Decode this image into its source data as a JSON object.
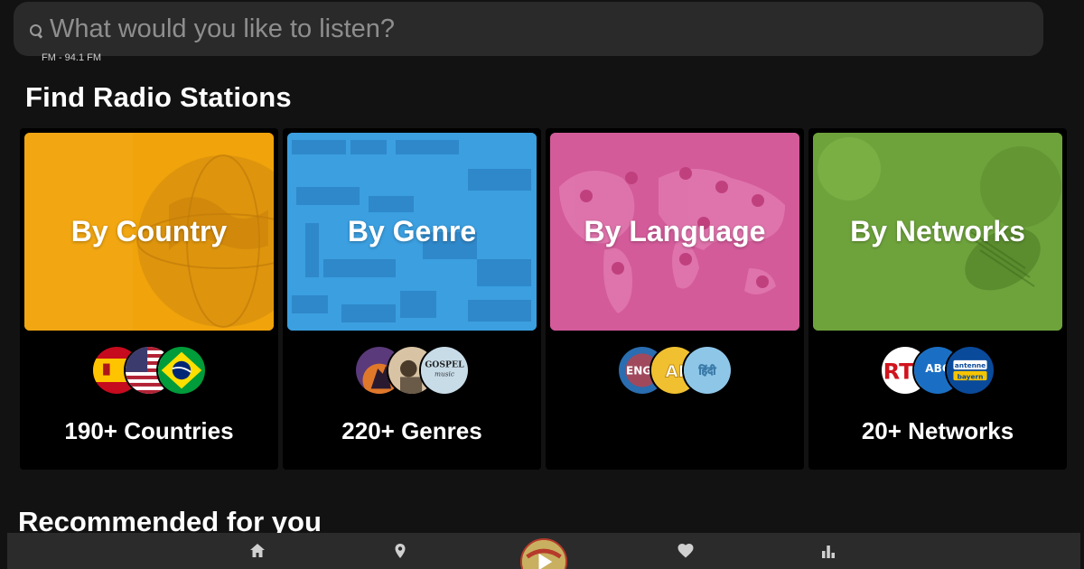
{
  "search": {
    "placeholder": "What would you like to listen?"
  },
  "now_playing_peek": "FM - 94.1 FM",
  "find_section": {
    "title": "Find Radio Stations"
  },
  "cards": [
    {
      "title": "By Country",
      "count": "190+ Countries",
      "color": "#f0a30a",
      "badges": [
        "spain-flag-icon",
        "usa-flag-icon",
        "brazil-flag-icon"
      ]
    },
    {
      "title": "By Genre",
      "count": "220+ Genres",
      "color": "#3b9fe0",
      "badges": [
        "rock-genre-icon",
        "pop-genre-icon",
        "gospel-genre-icon"
      ]
    },
    {
      "title": "By Language",
      "count": "",
      "color": "#d35b9a",
      "badges": [
        "english-language-icon",
        "arabic-language-icon",
        "hindi-language-icon"
      ]
    },
    {
      "title": "By Networks",
      "count": "20+ Networks",
      "color": "#6ea33c",
      "badges": [
        "rt-network-icon",
        "abc-australia-network-icon",
        "antenne-bayern-network-icon"
      ]
    }
  ],
  "badge_text": {
    "language_1": "ENGL",
    "language_2": "AI",
    "language_3": "हिंदी",
    "genre_3": "GOSPEL",
    "genre_3_sub": "music",
    "network_1": "RT",
    "network_2": "ABC",
    "network_3_line1": "antenne",
    "network_3_line2": "bayern"
  },
  "recommended": {
    "title": "Recommended for you"
  },
  "bottom_nav": [
    "home-icon",
    "location-icon",
    "player-button",
    "heart-icon",
    "chart-icon"
  ]
}
